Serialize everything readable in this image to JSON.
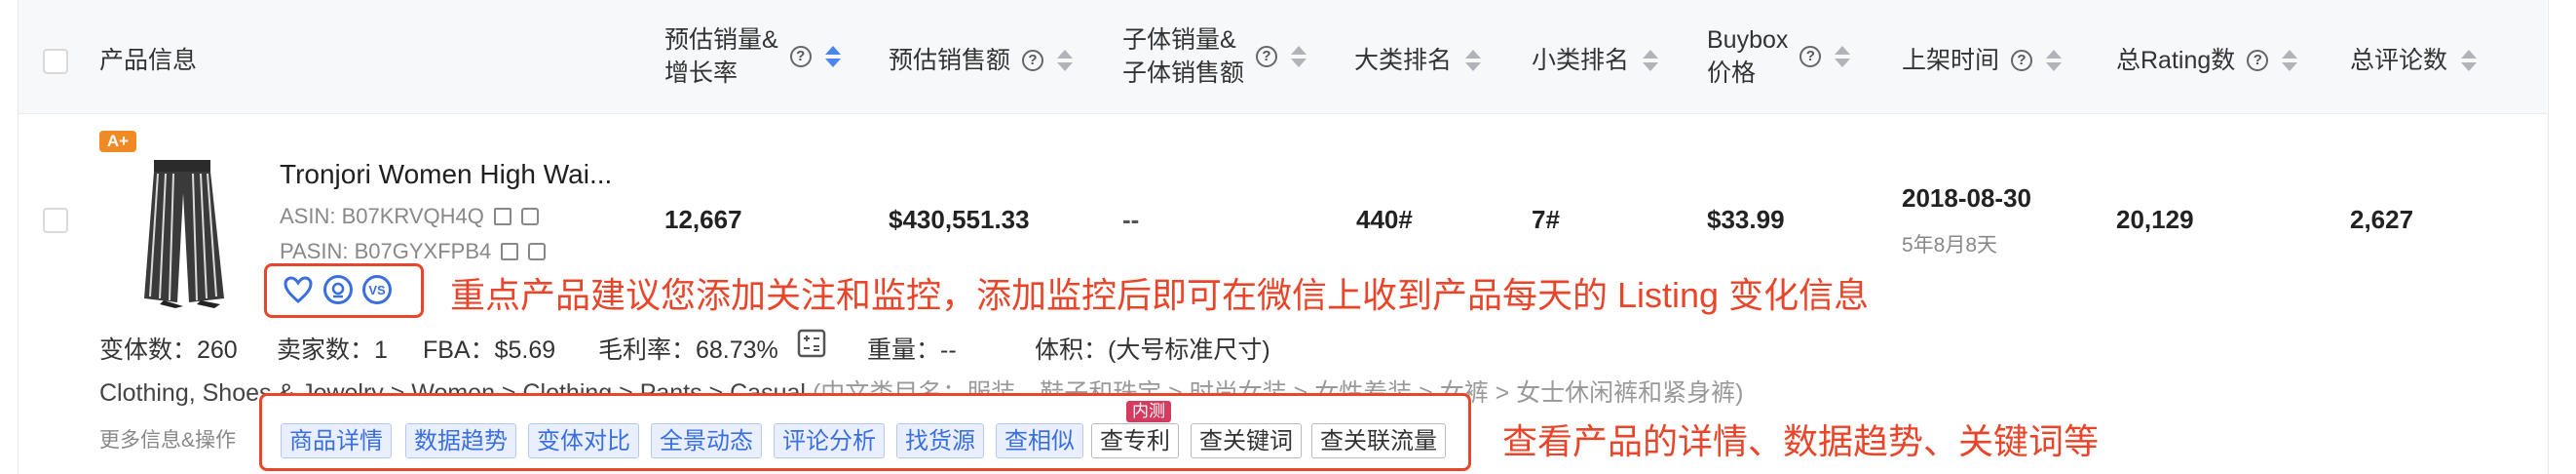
{
  "header": {
    "columns": [
      {
        "id": "product",
        "label": "产品信息",
        "help": false,
        "sort": false
      },
      {
        "id": "sales",
        "label": "预估销量&\n增长率",
        "help": true,
        "sort": true,
        "active": true
      },
      {
        "id": "revenue",
        "label": "预估销售额",
        "help": true,
        "sort": true
      },
      {
        "id": "variant_sales",
        "label": "子体销量&\n子体销售额",
        "help": true,
        "sort": true
      },
      {
        "id": "main_rank",
        "label": "大类排名",
        "help": false,
        "sort": true
      },
      {
        "id": "sub_rank",
        "label": "小类排名",
        "help": false,
        "sort": true
      },
      {
        "id": "buybox",
        "label": "Buybox\n价格",
        "help": true,
        "sort": true
      },
      {
        "id": "launch",
        "label": "上架时间",
        "help": true,
        "sort": true
      },
      {
        "id": "rating",
        "label": "总Rating数",
        "help": true,
        "sort": true
      },
      {
        "id": "reviews",
        "label": "总评论数",
        "help": false,
        "sort": true
      }
    ]
  },
  "product": {
    "badge": "A+",
    "title": "Tronjori Women High Wai...",
    "asin": "ASIN: B07KRVQH4Q",
    "pasin": "PASIN: B07GYXFPB4",
    "sales": "12,667",
    "revenue": "$430,551.33",
    "variant_sales": "--",
    "main_rank": "440#",
    "sub_rank": "7#",
    "buybox": "$33.99",
    "launch_date": "2018-08-30",
    "launch_age": "5年8月8天",
    "rating_count": "20,129",
    "review_count": "2,627",
    "action_icons": [
      "heart-icon",
      "monitor-icon",
      "vs-icon"
    ],
    "vs_label": "VS"
  },
  "meta": {
    "variants": "变体数：260",
    "sellers": "卖家数：1",
    "fba": "FBA：$5.69",
    "margin": "毛利率：68.73%",
    "weight": "重量：--",
    "volume": "体积：(大号标准尺寸)",
    "category_en": "Clothing, Shoes & Jewelry > Women > Clothing > Pants > Casual",
    "category_cn": "(中文类目名：服装、鞋子和珠宝 > 时尚女装 > 女性着装 > 女裤 > 女士休闲裤和紧身裤)"
  },
  "more": {
    "label": "更多信息&操作",
    "buttons": [
      "商品详情",
      "数据趋势",
      "变体对比",
      "全景动态",
      "评论分析",
      "找货源",
      "查相似",
      "查专利",
      "查关键词",
      "查关联流量"
    ],
    "new_tag": "内测"
  },
  "annotations": {
    "monitor_tip": "重点产品建议您添加关注和监控，添加监控后即可在微信上收到产品每天的 Listing 变化信息",
    "actions_tip": "查看产品的详情、数据趋势、关键词等"
  },
  "colors": {
    "accent": "#3a6fe0",
    "annotation": "#e8452a",
    "badge": "#f08a24",
    "new_tag": "#d63a5e"
  }
}
